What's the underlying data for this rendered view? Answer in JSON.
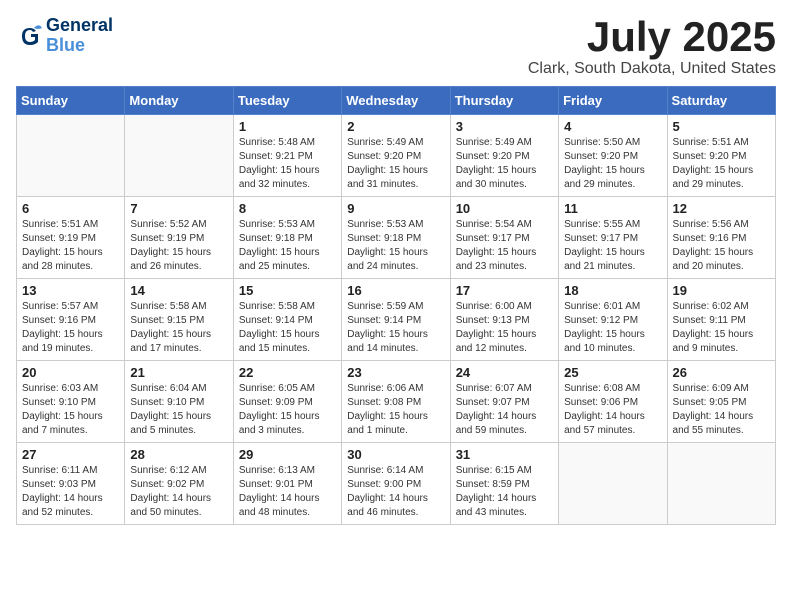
{
  "logo": {
    "line1": "General",
    "line2": "Blue"
  },
  "title": "July 2025",
  "location": "Clark, South Dakota, United States",
  "days_of_week": [
    "Sunday",
    "Monday",
    "Tuesday",
    "Wednesday",
    "Thursday",
    "Friday",
    "Saturday"
  ],
  "weeks": [
    [
      {
        "day": "",
        "info": ""
      },
      {
        "day": "",
        "info": ""
      },
      {
        "day": "1",
        "info": "Sunrise: 5:48 AM\nSunset: 9:21 PM\nDaylight: 15 hours\nand 32 minutes."
      },
      {
        "day": "2",
        "info": "Sunrise: 5:49 AM\nSunset: 9:20 PM\nDaylight: 15 hours\nand 31 minutes."
      },
      {
        "day": "3",
        "info": "Sunrise: 5:49 AM\nSunset: 9:20 PM\nDaylight: 15 hours\nand 30 minutes."
      },
      {
        "day": "4",
        "info": "Sunrise: 5:50 AM\nSunset: 9:20 PM\nDaylight: 15 hours\nand 29 minutes."
      },
      {
        "day": "5",
        "info": "Sunrise: 5:51 AM\nSunset: 9:20 PM\nDaylight: 15 hours\nand 29 minutes."
      }
    ],
    [
      {
        "day": "6",
        "info": "Sunrise: 5:51 AM\nSunset: 9:19 PM\nDaylight: 15 hours\nand 28 minutes."
      },
      {
        "day": "7",
        "info": "Sunrise: 5:52 AM\nSunset: 9:19 PM\nDaylight: 15 hours\nand 26 minutes."
      },
      {
        "day": "8",
        "info": "Sunrise: 5:53 AM\nSunset: 9:18 PM\nDaylight: 15 hours\nand 25 minutes."
      },
      {
        "day": "9",
        "info": "Sunrise: 5:53 AM\nSunset: 9:18 PM\nDaylight: 15 hours\nand 24 minutes."
      },
      {
        "day": "10",
        "info": "Sunrise: 5:54 AM\nSunset: 9:17 PM\nDaylight: 15 hours\nand 23 minutes."
      },
      {
        "day": "11",
        "info": "Sunrise: 5:55 AM\nSunset: 9:17 PM\nDaylight: 15 hours\nand 21 minutes."
      },
      {
        "day": "12",
        "info": "Sunrise: 5:56 AM\nSunset: 9:16 PM\nDaylight: 15 hours\nand 20 minutes."
      }
    ],
    [
      {
        "day": "13",
        "info": "Sunrise: 5:57 AM\nSunset: 9:16 PM\nDaylight: 15 hours\nand 19 minutes."
      },
      {
        "day": "14",
        "info": "Sunrise: 5:58 AM\nSunset: 9:15 PM\nDaylight: 15 hours\nand 17 minutes."
      },
      {
        "day": "15",
        "info": "Sunrise: 5:58 AM\nSunset: 9:14 PM\nDaylight: 15 hours\nand 15 minutes."
      },
      {
        "day": "16",
        "info": "Sunrise: 5:59 AM\nSunset: 9:14 PM\nDaylight: 15 hours\nand 14 minutes."
      },
      {
        "day": "17",
        "info": "Sunrise: 6:00 AM\nSunset: 9:13 PM\nDaylight: 15 hours\nand 12 minutes."
      },
      {
        "day": "18",
        "info": "Sunrise: 6:01 AM\nSunset: 9:12 PM\nDaylight: 15 hours\nand 10 minutes."
      },
      {
        "day": "19",
        "info": "Sunrise: 6:02 AM\nSunset: 9:11 PM\nDaylight: 15 hours\nand 9 minutes."
      }
    ],
    [
      {
        "day": "20",
        "info": "Sunrise: 6:03 AM\nSunset: 9:10 PM\nDaylight: 15 hours\nand 7 minutes."
      },
      {
        "day": "21",
        "info": "Sunrise: 6:04 AM\nSunset: 9:10 PM\nDaylight: 15 hours\nand 5 minutes."
      },
      {
        "day": "22",
        "info": "Sunrise: 6:05 AM\nSunset: 9:09 PM\nDaylight: 15 hours\nand 3 minutes."
      },
      {
        "day": "23",
        "info": "Sunrise: 6:06 AM\nSunset: 9:08 PM\nDaylight: 15 hours\nand 1 minute."
      },
      {
        "day": "24",
        "info": "Sunrise: 6:07 AM\nSunset: 9:07 PM\nDaylight: 14 hours\nand 59 minutes."
      },
      {
        "day": "25",
        "info": "Sunrise: 6:08 AM\nSunset: 9:06 PM\nDaylight: 14 hours\nand 57 minutes."
      },
      {
        "day": "26",
        "info": "Sunrise: 6:09 AM\nSunset: 9:05 PM\nDaylight: 14 hours\nand 55 minutes."
      }
    ],
    [
      {
        "day": "27",
        "info": "Sunrise: 6:11 AM\nSunset: 9:03 PM\nDaylight: 14 hours\nand 52 minutes."
      },
      {
        "day": "28",
        "info": "Sunrise: 6:12 AM\nSunset: 9:02 PM\nDaylight: 14 hours\nand 50 minutes."
      },
      {
        "day": "29",
        "info": "Sunrise: 6:13 AM\nSunset: 9:01 PM\nDaylight: 14 hours\nand 48 minutes."
      },
      {
        "day": "30",
        "info": "Sunrise: 6:14 AM\nSunset: 9:00 PM\nDaylight: 14 hours\nand 46 minutes."
      },
      {
        "day": "31",
        "info": "Sunrise: 6:15 AM\nSunset: 8:59 PM\nDaylight: 14 hours\nand 43 minutes."
      },
      {
        "day": "",
        "info": ""
      },
      {
        "day": "",
        "info": ""
      }
    ]
  ]
}
